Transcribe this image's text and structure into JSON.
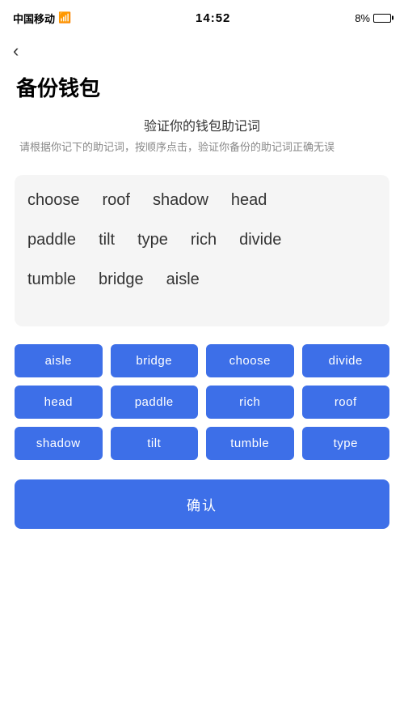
{
  "statusBar": {
    "carrier": "中国移动",
    "time": "14:52",
    "battery": "8%"
  },
  "nav": {
    "backIcon": "‹"
  },
  "page": {
    "title": "备份钱包",
    "subtitleMain": "验证你的钱包助记词",
    "subtitleDesc": "请根据你记下的助记词，按顺序点击，验证你备份的助记词正确无误"
  },
  "displayWords": [
    {
      "text": "choose",
      "selected": false
    },
    {
      "text": "roof",
      "selected": false
    },
    {
      "text": "shadow",
      "selected": false
    },
    {
      "text": "head",
      "selected": false
    },
    {
      "text": "paddle",
      "selected": false
    },
    {
      "text": "tilt",
      "selected": false
    },
    {
      "text": "type",
      "selected": false
    },
    {
      "text": "rich",
      "selected": false
    },
    {
      "text": "divide",
      "selected": false
    },
    {
      "text": "tumble",
      "selected": false
    },
    {
      "text": "bridge",
      "selected": false
    },
    {
      "text": "aisle",
      "selected": false
    }
  ],
  "wordButtons": [
    "aisle",
    "bridge",
    "choose",
    "divide",
    "head",
    "paddle",
    "rich",
    "roof",
    "shadow",
    "tilt",
    "tumble",
    "type"
  ],
  "confirmButton": {
    "label": "确认"
  }
}
